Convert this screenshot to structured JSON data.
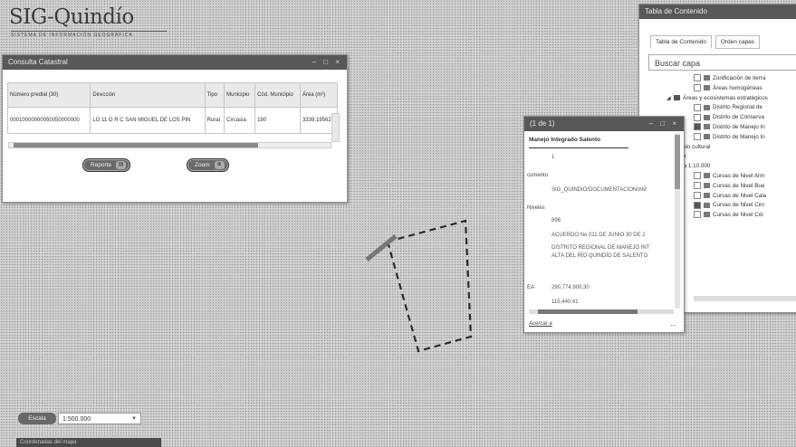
{
  "logo": {
    "name": "SIG-Quindío",
    "subtitle": "SISTEMA DE INFORMACIÓN GEOGRÁFICA"
  },
  "cadastral": {
    "title": "Consulta Catastral",
    "controls": "– □ ×",
    "columns": [
      "Número predial (30)",
      "Dirección",
      "Tipo",
      "Municipio",
      "Cód. Municipio",
      "Área (m²)"
    ],
    "rows": [
      [
        "00010000000050050000000",
        "LO 11 O R C SAN MIGUEL DE LOS PIN",
        "Rural",
        "Circasia",
        "190",
        "3339.19562"
      ]
    ],
    "buttons": {
      "report": "Reporte",
      "zoom": "Zoom"
    }
  },
  "toc": {
    "title": "Tabla de Contenido",
    "tabs": [
      "Tabla de Contenido",
      "Orden capas"
    ],
    "search_placeholder": "Buscar capa",
    "items": [
      {
        "label": "Zonificación de tierra",
        "kind": "layer",
        "checked": false,
        "indent": 4
      },
      {
        "label": "Áreas homogéneas",
        "kind": "layer",
        "checked": false,
        "indent": 4
      },
      {
        "label": "Áreas y ecosistemas estratégicos",
        "kind": "folder",
        "indent": 2
      },
      {
        "label": "Distrito Regional de",
        "kind": "layer",
        "checked": false,
        "indent": 4
      },
      {
        "label": "Distrito de Conserva",
        "kind": "layer",
        "checked": false,
        "indent": 4
      },
      {
        "label": "Distrito de Manejo In",
        "kind": "layer",
        "checked": true,
        "indent": 4
      },
      {
        "label": "Distrito de Manejo In",
        "kind": "layer",
        "checked": false,
        "indent": 4
      },
      {
        "label": "Áreas de patrimonio cultural",
        "kind": "text",
        "indent": 0
      },
      {
        "label": "Cartografía básica",
        "kind": "text",
        "indent": 0
      },
      {
        "label": "Cartografía Básica 1:10.000",
        "kind": "text",
        "indent": 0
      },
      {
        "label": "Curvas de Nivel Arm",
        "kind": "layer",
        "checked": false,
        "indent": 4
      },
      {
        "label": "Curvas de Nivel Bue",
        "kind": "layer",
        "checked": false,
        "indent": 4
      },
      {
        "label": "Curvas de Nivel Cala",
        "kind": "layer",
        "checked": false,
        "indent": 4
      },
      {
        "label": "Curvas de Nivel Circ",
        "kind": "layer",
        "checked": true,
        "indent": 4
      },
      {
        "label": "Curvas de Nivel Cór",
        "kind": "layer",
        "checked": false,
        "indent": 4
      }
    ]
  },
  "popup": {
    "header": "(1 de 1)",
    "controls": "– □ ×",
    "title": "Manejo Integrado Salento",
    "fields": [
      {
        "label": "",
        "value": "1"
      },
      {
        "label": "cumento",
        "value": "SIG_QUINDIO/DOCUMENTACION/AM"
      },
      {
        "label": "Niveles",
        "value": ""
      },
      {
        "label": "",
        "value": "898"
      },
      {
        "label": "",
        "value": "ACUERDO No 011 DE JUNIO 30 DE 2"
      },
      {
        "label": "",
        "value": "DISTRITO REGIONAL DE MANEJO INT"
      },
      {
        "label": "",
        "value": "ALTA DEL RÍO QUINDÍO DE SALENTO"
      },
      {
        "label": "EA",
        "value": "290,774,900.30"
      },
      {
        "label": "",
        "value": "115,440.41"
      }
    ],
    "footer": "Acercar a",
    "more": "..."
  },
  "scale": {
    "button": "Escala",
    "value": "1:500.000"
  },
  "coords": {
    "text": "Coordenadas del mapa"
  }
}
